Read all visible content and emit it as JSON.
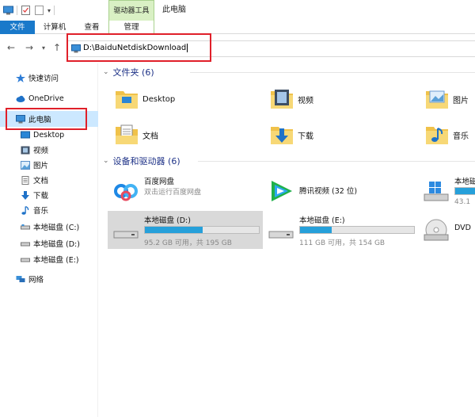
{
  "window": {
    "contextual_group": "驱动器工具",
    "title": "此电脑"
  },
  "ribbon": {
    "tabs": [
      {
        "label": "文件",
        "active": true
      },
      {
        "label": "计算机"
      },
      {
        "label": "查看"
      },
      {
        "label": "管理"
      }
    ]
  },
  "address": {
    "path": "D:\\BaiduNetdiskDownload",
    "icon": "this-pc-icon"
  },
  "nav": {
    "items": [
      {
        "label": "快速访问",
        "icon": "star-icon"
      },
      {
        "label": "OneDrive",
        "icon": "cloud-icon"
      },
      {
        "label": "此电脑",
        "icon": "this-pc-icon",
        "selected": true
      },
      {
        "label": "Desktop",
        "icon": "desktop-icon"
      },
      {
        "label": "视频",
        "icon": "video-icon"
      },
      {
        "label": "图片",
        "icon": "pictures-icon"
      },
      {
        "label": "文档",
        "icon": "document-icon"
      },
      {
        "label": "下载",
        "icon": "download-icon"
      },
      {
        "label": "音乐",
        "icon": "music-icon"
      },
      {
        "label": "本地磁盘 (C:)",
        "icon": "drive-icon"
      },
      {
        "label": "本地磁盘 (D:)",
        "icon": "drive-icon"
      },
      {
        "label": "本地磁盘 (E:)",
        "icon": "drive-icon"
      },
      {
        "label": "网络",
        "icon": "network-icon"
      }
    ]
  },
  "folders_section": {
    "header": "文件夹 (6)",
    "items": [
      {
        "label": "Desktop",
        "icon": "desktop-folder-icon"
      },
      {
        "label": "视频",
        "icon": "video-folder-icon"
      },
      {
        "label": "图片",
        "icon": "pictures-folder-icon"
      },
      {
        "label": "文档",
        "icon": "documents-folder-icon"
      },
      {
        "label": "下载",
        "icon": "downloads-folder-icon"
      },
      {
        "label": "音乐",
        "icon": "music-folder-icon"
      }
    ]
  },
  "devices_section": {
    "header": "设备和驱动器 (6)",
    "items": [
      {
        "name": "百度网盘",
        "sub": "双击运行百度网盘",
        "icon": "baidu-netdisk-icon"
      },
      {
        "name": "腾讯视频 (32 位)",
        "icon": "tencent-video-icon"
      },
      {
        "name": "本地磁",
        "free": "43.1",
        "icon": "windows-drive-icon",
        "used_fraction": 0.78
      },
      {
        "name": "本地磁盘 (D:)",
        "free": "95.2 GB 可用，共 195 GB",
        "icon": "drive-icon",
        "used_fraction": 0.51,
        "selected": true
      },
      {
        "name": "本地磁盘 (E:)",
        "free": "111 GB 可用，共 154 GB",
        "icon": "drive-icon",
        "used_fraction": 0.28
      },
      {
        "name": "DVD",
        "icon": "dvd-drive-icon"
      }
    ]
  },
  "colors": {
    "accent": "#1979ca",
    "selection": "#cce8ff",
    "highlight_box": "#e0202a",
    "section_header": "#1e3287",
    "capacity_fill": "#26a0da"
  }
}
